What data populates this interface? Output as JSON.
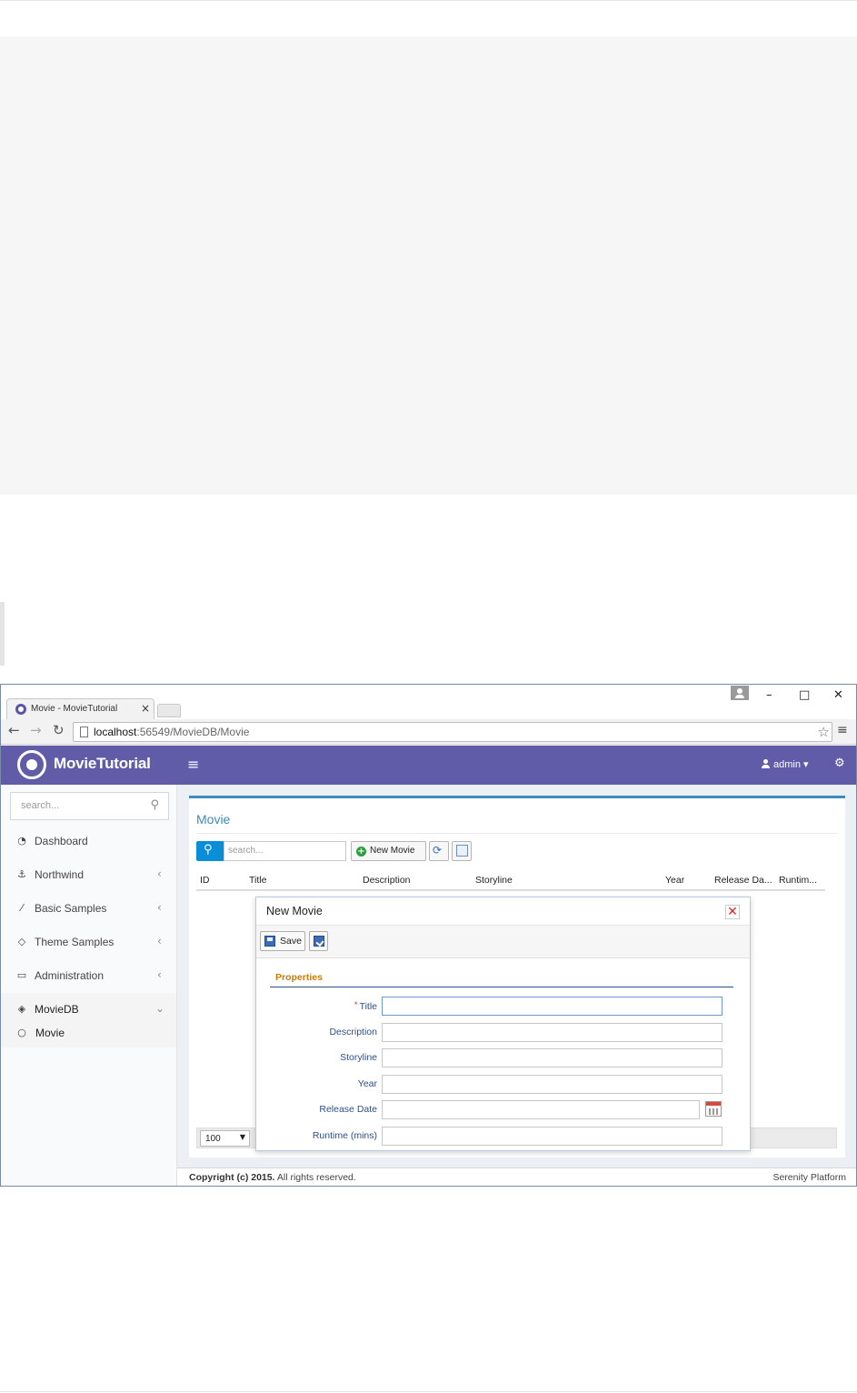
{
  "browser": {
    "tab_title": "Movie - MovieTutorial",
    "tab_close": "×",
    "url_host": "localhost",
    "url_rest": ":56549/MovieDB/Movie",
    "window_buttons": [
      "–",
      "□",
      "✕"
    ]
  },
  "header": {
    "brand": "MovieTutorial",
    "user": "admin"
  },
  "sidebar": {
    "search_placeholder": "search...",
    "items": [
      {
        "label": "Dashboard",
        "icon": "dashboard-icon",
        "has_children": false
      },
      {
        "label": "Northwind",
        "icon": "anchor-icon",
        "has_children": true
      },
      {
        "label": "Basic Samples",
        "icon": "magic-wand-icon",
        "has_children": true
      },
      {
        "label": "Theme Samples",
        "icon": "diamond-icon",
        "has_children": true
      },
      {
        "label": "Administration",
        "icon": "desktop-icon",
        "has_children": true
      },
      {
        "label": "MovieDB",
        "icon": "layers-icon",
        "has_children": true,
        "expanded": true
      }
    ],
    "subitems": [
      {
        "label": "Movie",
        "icon": "circle-icon"
      }
    ]
  },
  "main": {
    "title": "Movie",
    "search_placeholder": "search...",
    "new_button": "New Movie",
    "columns": [
      "ID",
      "Title",
      "Description",
      "Storyline",
      "Year",
      "Release Da...",
      "Runtim..."
    ],
    "page_size": "100"
  },
  "dialog": {
    "title": "New Movie",
    "save_label": "Save",
    "section_title": "Properties",
    "fields": [
      {
        "label": "Title",
        "required": true,
        "value": ""
      },
      {
        "label": "Description",
        "required": false,
        "value": ""
      },
      {
        "label": "Storyline",
        "required": false,
        "value": ""
      },
      {
        "label": "Year",
        "required": false,
        "value": ""
      },
      {
        "label": "Release Date",
        "required": false,
        "value": ""
      },
      {
        "label": "Runtime (mins)",
        "required": false,
        "value": ""
      }
    ]
  },
  "footer": {
    "copyright": "Copyright (c) 2015.",
    "rights": " All rights reserved.",
    "platform": "Serenity Platform"
  },
  "colors": {
    "header_bg": "#605ca8",
    "accent_blue": "#3c8dbc",
    "search_button": "#0a8ed8",
    "label_blue": "#2d4f8a",
    "section_orange": "#cc7a00"
  }
}
